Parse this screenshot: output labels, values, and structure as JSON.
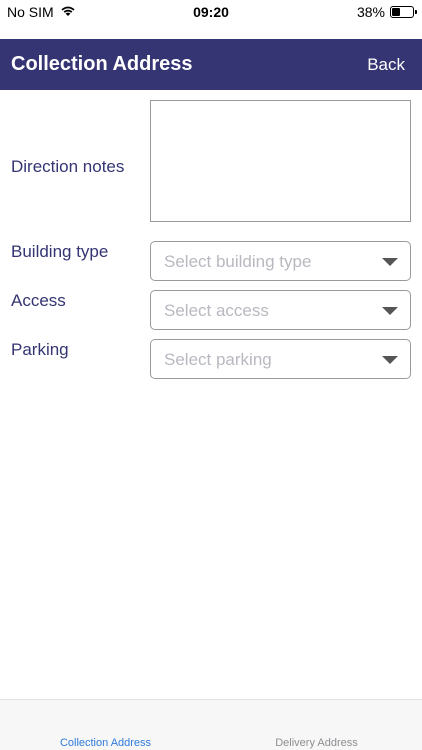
{
  "status_bar": {
    "carrier": "No SIM",
    "time": "09:20",
    "battery_percent": "38%",
    "battery_level": 0.38
  },
  "nav": {
    "title": "Collection Address",
    "back_label": "Back"
  },
  "form": {
    "direction_notes_label": "Direction notes",
    "direction_notes_value": "",
    "building_type_label": "Building type",
    "building_type_placeholder": "Select building type",
    "access_label": "Access",
    "access_placeholder": "Select access",
    "parking_label": "Parking",
    "parking_placeholder": "Select parking"
  },
  "tabs": [
    {
      "label": "Collection Address",
      "active": true
    },
    {
      "label": "Delivery Address",
      "active": false
    }
  ],
  "colors": {
    "header_bg": "#343572",
    "label_text": "#343572",
    "active_tab": "#2f7bd9",
    "inactive_tab": "#8e8e93"
  }
}
